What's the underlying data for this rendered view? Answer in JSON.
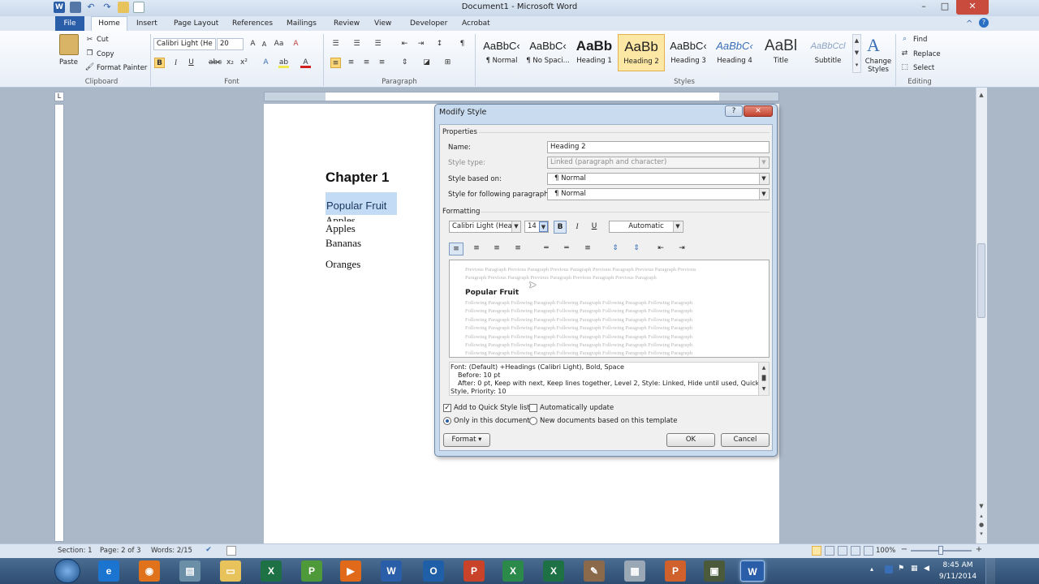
{
  "window": {
    "title": "Document1 - Microsoft Word",
    "controls": {
      "minimize": "–",
      "maximize": "□",
      "close": "✕"
    }
  },
  "tabs": {
    "file": "File",
    "home": "Home",
    "items": [
      "Insert",
      "Page Layout",
      "References",
      "Mailings",
      "Review",
      "View",
      "Developer",
      "Acrobat"
    ]
  },
  "ribbon": {
    "clipboard": {
      "paste": "Paste",
      "cut": "Cut",
      "copy": "Copy",
      "format_painter": "Format Painter",
      "label": "Clipboard"
    },
    "font": {
      "name": "Calibri Light (He",
      "size": "20",
      "label": "Font"
    },
    "paragraph": {
      "label": "Paragraph"
    },
    "styles": {
      "label": "Styles",
      "items": [
        {
          "sample": "AaBbC‹",
          "name": "¶ Normal"
        },
        {
          "sample": "AaBbC‹",
          "name": "¶ No Spaci..."
        },
        {
          "sample": "AaBb",
          "name": "Heading 1"
        },
        {
          "sample": "AaBb",
          "name": "Heading 2"
        },
        {
          "sample": "AaBbC‹",
          "name": "Heading 3"
        },
        {
          "sample": "AaBbC‹",
          "name": "Heading 4"
        },
        {
          "sample": "AaBl",
          "name": "Title"
        },
        {
          "sample": "AaBbCcl",
          "name": "Subtitle"
        }
      ],
      "change_styles": "Change Styles"
    },
    "editing": {
      "find": "Find",
      "replace": "Replace",
      "select": "Select",
      "label": "Editing"
    }
  },
  "document": {
    "chapter": "Chapter 1",
    "heading": "Popular Fruit",
    "items": [
      "Apples",
      "Apples",
      "Bananas",
      "Oranges"
    ]
  },
  "dialog": {
    "title": "Modify Style",
    "help": "?",
    "close": "✕",
    "properties_label": "Properties",
    "name_label": "Name:",
    "name_value": "Heading 2",
    "style_type_label": "Style type:",
    "style_type_value": "Linked (paragraph and character)",
    "based_on_label": "Style based on:",
    "based_on_value": "¶ Normal",
    "following_label": "Style for following paragraph:",
    "following_value": "¶ Normal",
    "formatting_label": "Formatting",
    "font": "Calibri Light (Headin",
    "size": "14",
    "bold": "B",
    "italic": "I",
    "underline": "U",
    "color": "Automatic",
    "preview": {
      "previous_1": "Previous Paragraph Previous Paragraph Previous Paragraph Previous Paragraph Previous Paragraph Previous",
      "previous_2": "Paragraph Previous Paragraph Previous Paragraph Previous Paragraph Previous Paragraph",
      "sample": "Popular Fruit",
      "following": "Following Paragraph Following Paragraph Following Paragraph Following Paragraph Following Paragraph"
    },
    "description": [
      "Font: (Default) +Headings (Calibri Light), Bold, Space",
      "Before:  10 pt",
      "After:  0 pt, Keep with next, Keep lines together, Level 2, Style: Linked, Hide until used, Quick",
      "Style, Priority: 10"
    ],
    "add_quick_style": "Add to Quick Style list",
    "auto_update": "Automatically update",
    "only_this_doc": "Only in this document",
    "new_docs": "New documents based on this template",
    "format_button": "Format ▾",
    "ok": "OK",
    "cancel": "Cancel"
  },
  "status": {
    "section": "Section: 1",
    "page": "Page: 2 of 3",
    "words": "Words: 2/15",
    "zoom": "100%"
  },
  "taskbar": {
    "time": "8:45 AM",
    "date": "9/11/2014"
  },
  "colors": {
    "accent": "#2a5ea8",
    "selection": "#c4dbf6",
    "style_highlight": "#fde7a5"
  }
}
